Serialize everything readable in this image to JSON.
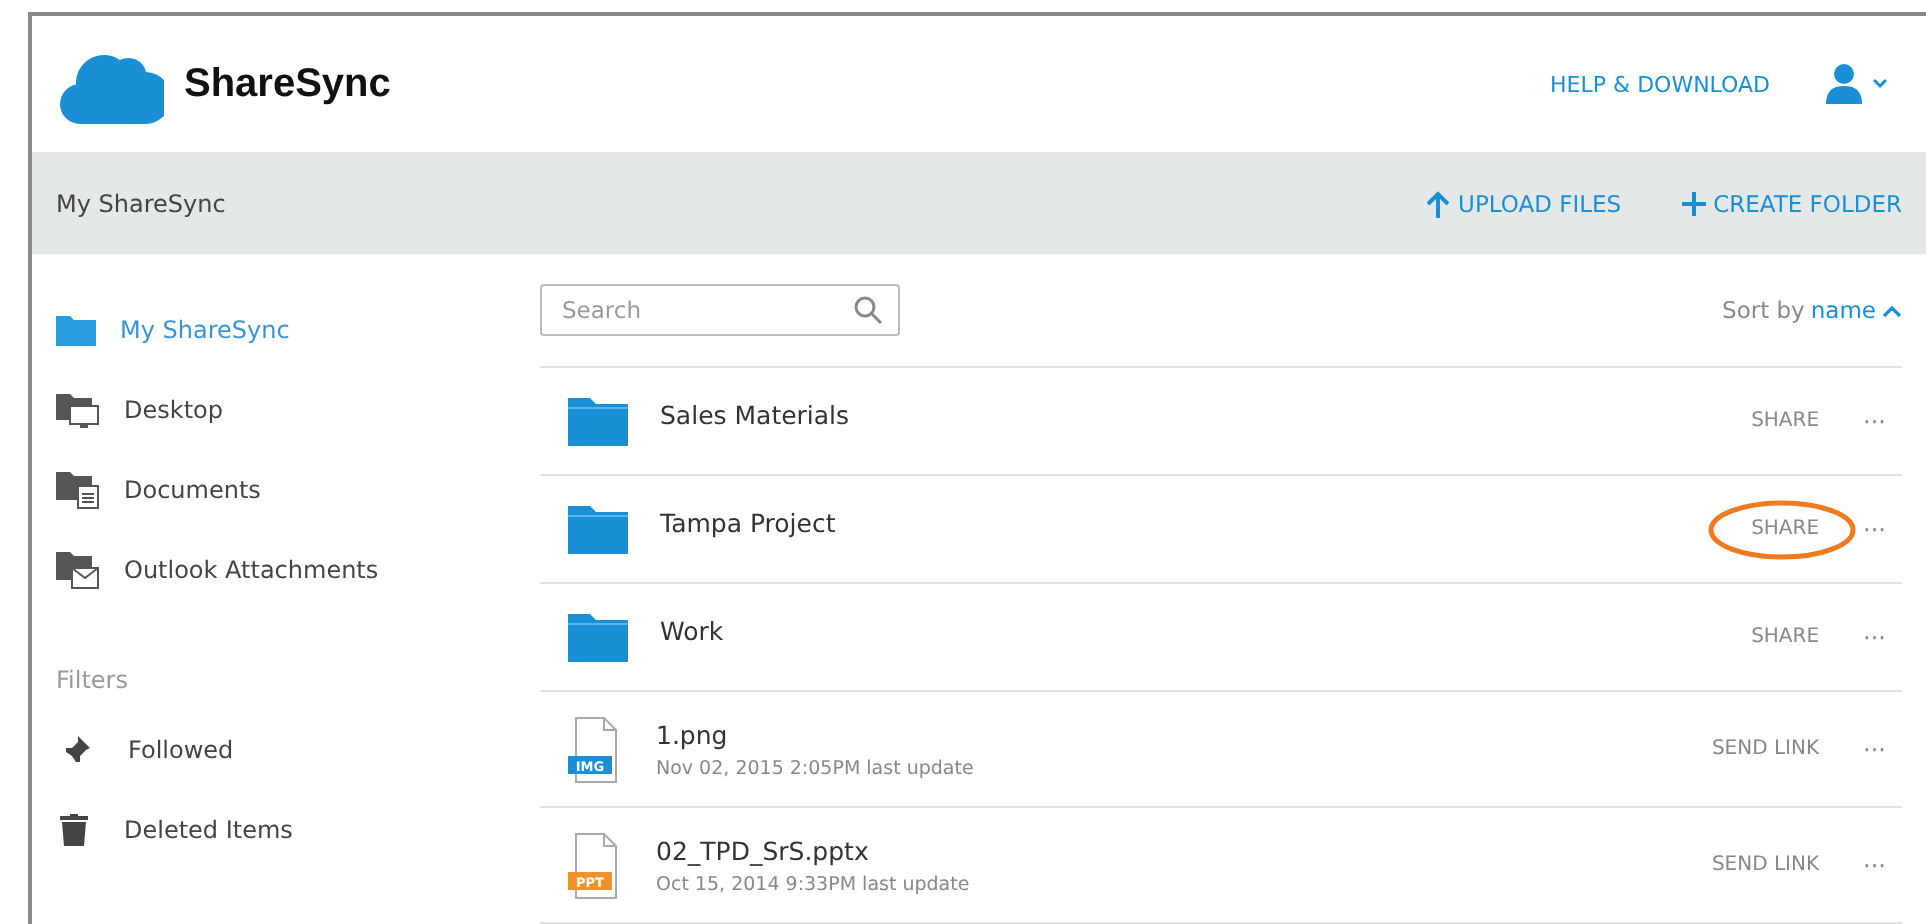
{
  "header": {
    "logo_text": "ShareSync",
    "help_link": "HELP & DOWNLOAD"
  },
  "toolbar": {
    "title": "My ShareSync",
    "actions": [
      {
        "kind": "upload",
        "label": "UPLOAD FILES"
      },
      {
        "kind": "create",
        "label": "CREATE FOLDER"
      }
    ]
  },
  "sidebar": {
    "items": [
      {
        "kind": "sync",
        "label": "My ShareSync",
        "selected": true
      },
      {
        "kind": "desktop",
        "label": "Desktop",
        "selected": false
      },
      {
        "kind": "documents",
        "label": "Documents",
        "selected": false
      },
      {
        "kind": "mail",
        "label": "Outlook Attachments",
        "selected": false
      }
    ],
    "filters_heading": "Filters",
    "filters": [
      {
        "kind": "pin",
        "label": "Followed"
      },
      {
        "kind": "trash",
        "label": "Deleted Items"
      }
    ]
  },
  "search": {
    "placeholder": "Search"
  },
  "sort": {
    "prefix": "Sort by",
    "field": "name"
  },
  "files": [
    {
      "kind": "folder",
      "name": "Sales Materials",
      "action": "SHARE",
      "more": "···",
      "highlighted": false
    },
    {
      "kind": "folder",
      "name": "Tampa Project",
      "action": "SHARE",
      "more": "···",
      "highlighted": true
    },
    {
      "kind": "folder",
      "name": "Work",
      "action": "SHARE",
      "more": "···",
      "highlighted": false
    },
    {
      "kind": "file",
      "name": "1.png",
      "badge": "IMG",
      "color": "#1a8fd6",
      "updated": "Nov 02, 2015 2:05PM last update",
      "action": "SEND LINK",
      "more": "···",
      "highlighted": false
    },
    {
      "kind": "file",
      "name": "02_TPD_SrS.pptx",
      "badge": "PPT",
      "color": "#f0922a",
      "updated": "Oct 15, 2014 9:33PM last update",
      "action": "SEND LINK",
      "more": "···",
      "highlighted": false
    }
  ]
}
